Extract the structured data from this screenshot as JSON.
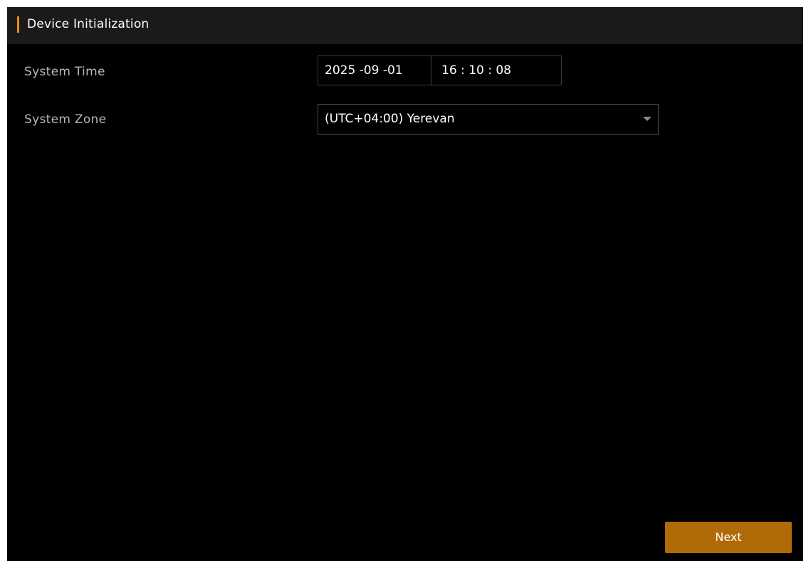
{
  "header": {
    "title": "Device Initialization",
    "accent_color": "#f08a10"
  },
  "form": {
    "system_time": {
      "label": "System Time",
      "date": "2025 -09 -01",
      "time": "16 : 10 : 08"
    },
    "system_zone": {
      "label": "System Zone",
      "value": "(UTC+04:00) Yerevan",
      "icon": "chevron-down-icon"
    }
  },
  "footer": {
    "next_label": "Next",
    "button_color": "#b06a08"
  }
}
